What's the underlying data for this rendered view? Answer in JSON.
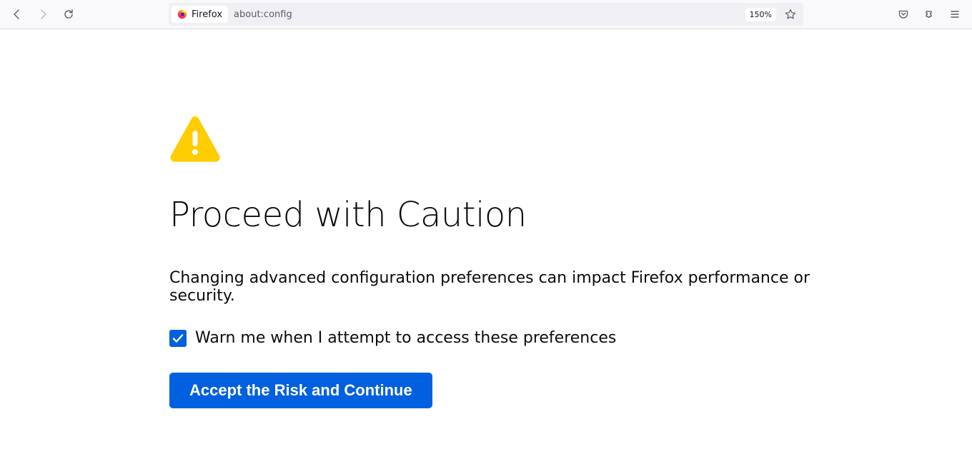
{
  "toolbar": {
    "identity_label": "Firefox",
    "url": "about:config",
    "zoom": "150%"
  },
  "page": {
    "title": "Proceed with Caution",
    "description": "Changing advanced configuration preferences can impact Firefox performance or security.",
    "checkbox_label": "Warn me when I attempt to access these preferences",
    "checkbox_checked": true,
    "button_label": "Accept the Risk and Continue"
  },
  "colors": {
    "primary": "#0060df",
    "warning": "#ffcd02"
  }
}
